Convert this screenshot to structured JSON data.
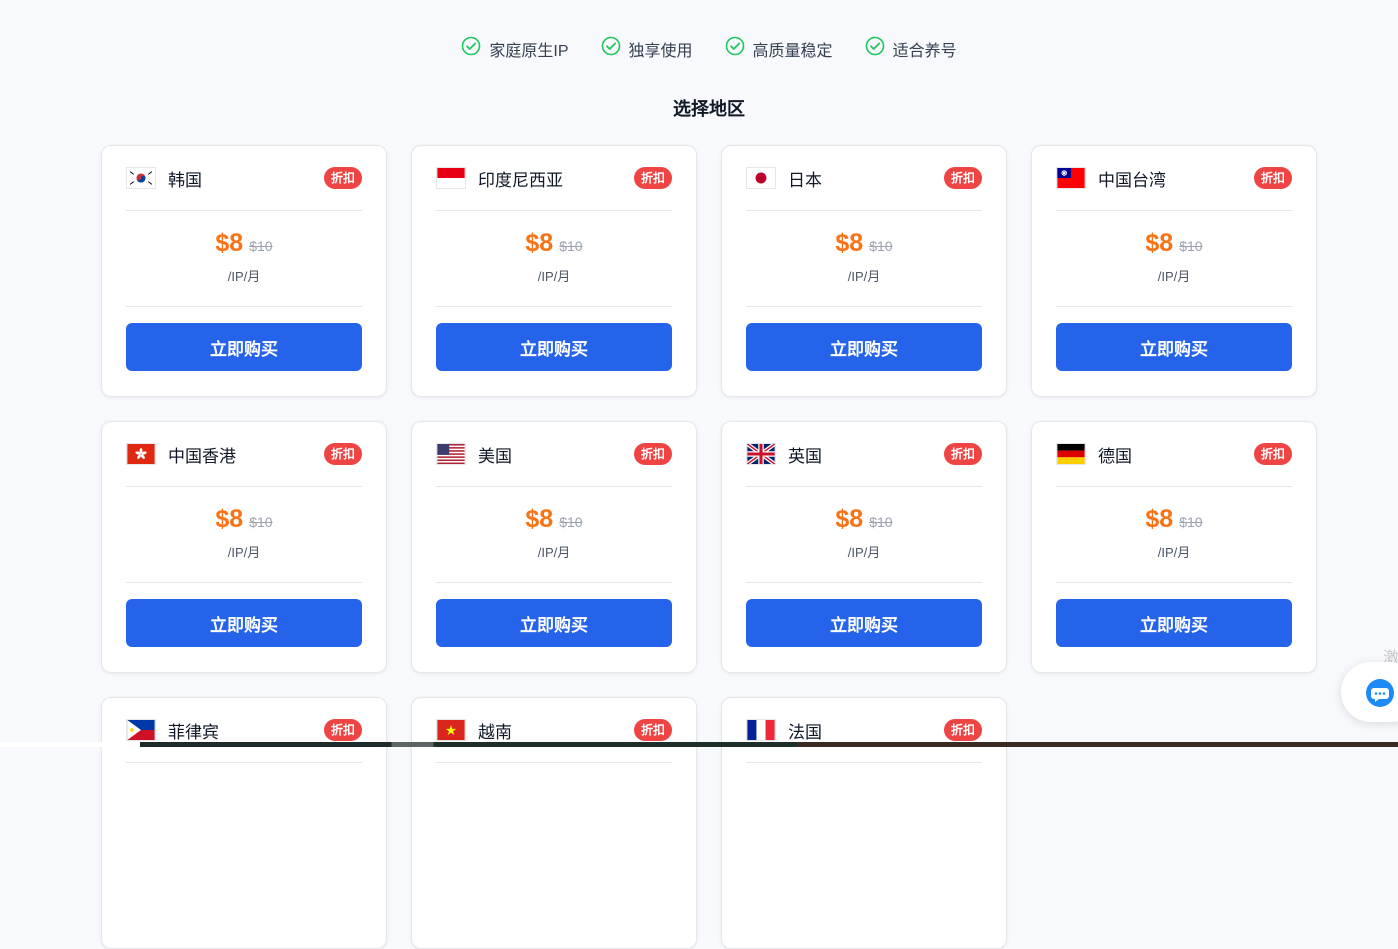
{
  "features": [
    {
      "label": "家庭原生IP",
      "icon": "check-circle-icon"
    },
    {
      "label": "独享使用",
      "icon": "check-circle-icon"
    },
    {
      "label": "高质量稳定",
      "icon": "check-circle-icon"
    },
    {
      "label": "适合养号",
      "icon": "check-circle-icon"
    }
  ],
  "section_title": "选择地区",
  "cards": [
    {
      "country": "韩国",
      "flag": "korea-flag-icon",
      "badge": "折扣",
      "price": "$8",
      "original_price": "$10",
      "unit": "/IP/月",
      "button": "立即购买"
    },
    {
      "country": "印度尼西亚",
      "flag": "indonesia-flag-icon",
      "badge": "折扣",
      "price": "$8",
      "original_price": "$10",
      "unit": "/IP/月",
      "button": "立即购买"
    },
    {
      "country": "日本",
      "flag": "japan-flag-icon",
      "badge": "折扣",
      "price": "$8",
      "original_price": "$10",
      "unit": "/IP/月",
      "button": "立即购买"
    },
    {
      "country": "中国台湾",
      "flag": "taiwan-flag-icon",
      "badge": "折扣",
      "price": "$8",
      "original_price": "$10",
      "unit": "/IP/月",
      "button": "立即购买"
    },
    {
      "country": "中国香港",
      "flag": "hongkong-flag-icon",
      "badge": "折扣",
      "price": "$8",
      "original_price": "$10",
      "unit": "/IP/月",
      "button": "立即购买"
    },
    {
      "country": "美国",
      "flag": "usa-flag-icon",
      "badge": "折扣",
      "price": "$8",
      "original_price": "$10",
      "unit": "/IP/月",
      "button": "立即购买"
    },
    {
      "country": "英国",
      "flag": "uk-flag-icon",
      "badge": "折扣",
      "price": "$8",
      "original_price": "$10",
      "unit": "/IP/月",
      "button": "立即购买"
    },
    {
      "country": "德国",
      "flag": "germany-flag-icon",
      "badge": "折扣",
      "price": "$8",
      "original_price": "$10",
      "unit": "/IP/月",
      "button": "立即购买"
    },
    {
      "country": "菲律宾",
      "flag": "philippines-flag-icon",
      "badge": "折扣"
    },
    {
      "country": "越南",
      "flag": "vietnam-flag-icon",
      "badge": "折扣"
    },
    {
      "country": "法国",
      "flag": "france-flag-icon",
      "badge": "折扣"
    }
  ],
  "chat_widget": {
    "icon": "chat-bubble-icon",
    "side_text": "激"
  },
  "colors": {
    "accent": "#2563eb",
    "price": "#f97316",
    "badge": "#ef4444",
    "check": "#22c55e"
  }
}
